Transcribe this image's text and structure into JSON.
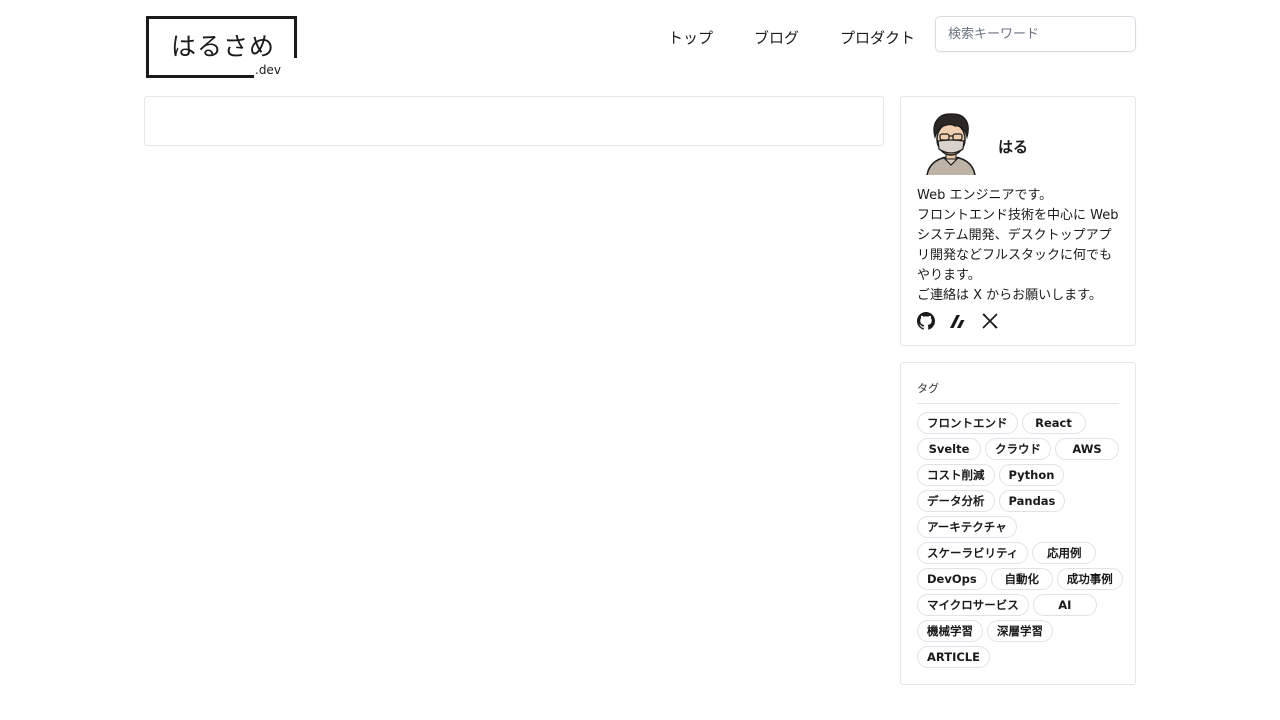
{
  "header": {
    "logo_text": "はるさめ",
    "logo_sub": ".dev",
    "nav": [
      "トップ",
      "ブログ",
      "プロダクト"
    ],
    "search_placeholder": "検索キーワード"
  },
  "profile": {
    "name": "はる",
    "bio": [
      "Web エンジニアです。",
      "フロントエンド技術を中心に Web システム開発、デスクトップアプリ開発などフルスタックに何でもやります。",
      "ご連絡は X からお願いします。"
    ],
    "socials": [
      "github-icon",
      "zenn-icon",
      "x-icon"
    ]
  },
  "tags": {
    "title": "タグ",
    "items": [
      "フロントエンド",
      "React",
      "Svelte",
      "クラウド",
      "AWS",
      "コスト削減",
      "Python",
      "データ分析",
      "Pandas",
      "アーキテクチャ",
      "スケーラビリティ",
      "応用例",
      "DevOps",
      "自動化",
      "成功事例",
      "マイクロサービス",
      "AI",
      "機械学習",
      "深層学習",
      "ARTICLE"
    ]
  }
}
